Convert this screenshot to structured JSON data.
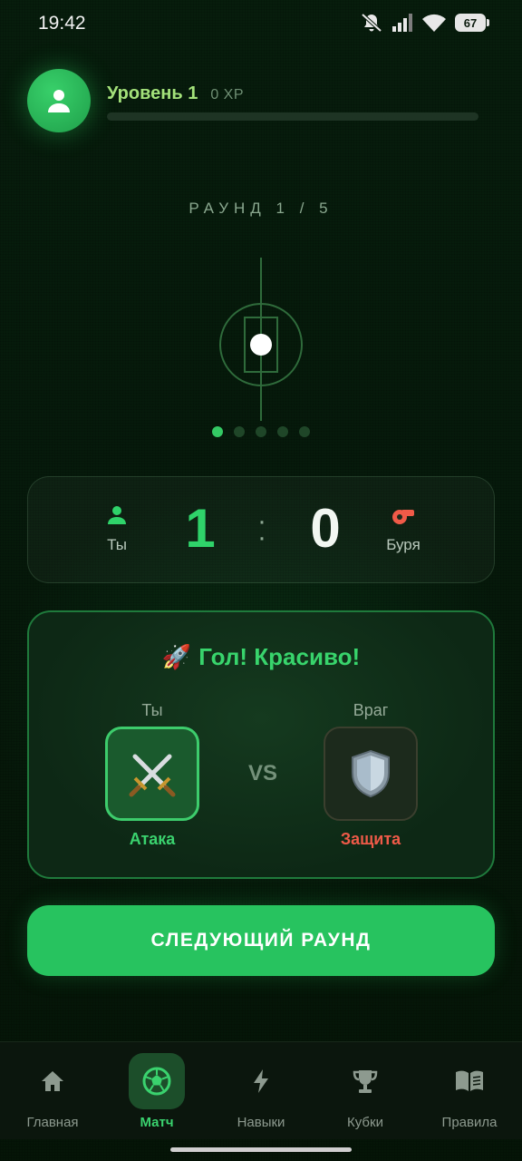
{
  "status_bar": {
    "time": "19:42",
    "battery": "67"
  },
  "header": {
    "level": "Уровень 1",
    "xp": "0 XP",
    "xp_progress": 0
  },
  "round": {
    "label": "РАУНД 1 / 5",
    "current": 1,
    "total": 5
  },
  "score": {
    "home_name": "Ты",
    "home_score": "1",
    "separator": ":",
    "away_name": "Буря",
    "away_score": "0"
  },
  "result": {
    "emoji": "🚀",
    "title": "Гол! Красиво!",
    "you_label": "Ты",
    "enemy_label": "Враг",
    "vs": "VS",
    "you_move": "Атака",
    "enemy_move": "Защита",
    "colors": {
      "you": "#3ad26e",
      "enemy": "#ef5a48"
    }
  },
  "next_button": "СЛЕДУЮЩИЙ РАУНД",
  "nav": [
    {
      "label": "Главная",
      "icon": "home-icon"
    },
    {
      "label": "Матч",
      "icon": "soccer-ball-icon"
    },
    {
      "label": "Навыки",
      "icon": "lightning-icon"
    },
    {
      "label": "Кубки",
      "icon": "trophy-icon"
    },
    {
      "label": "Правила",
      "icon": "book-icon"
    }
  ],
  "accent": "#27c35f"
}
